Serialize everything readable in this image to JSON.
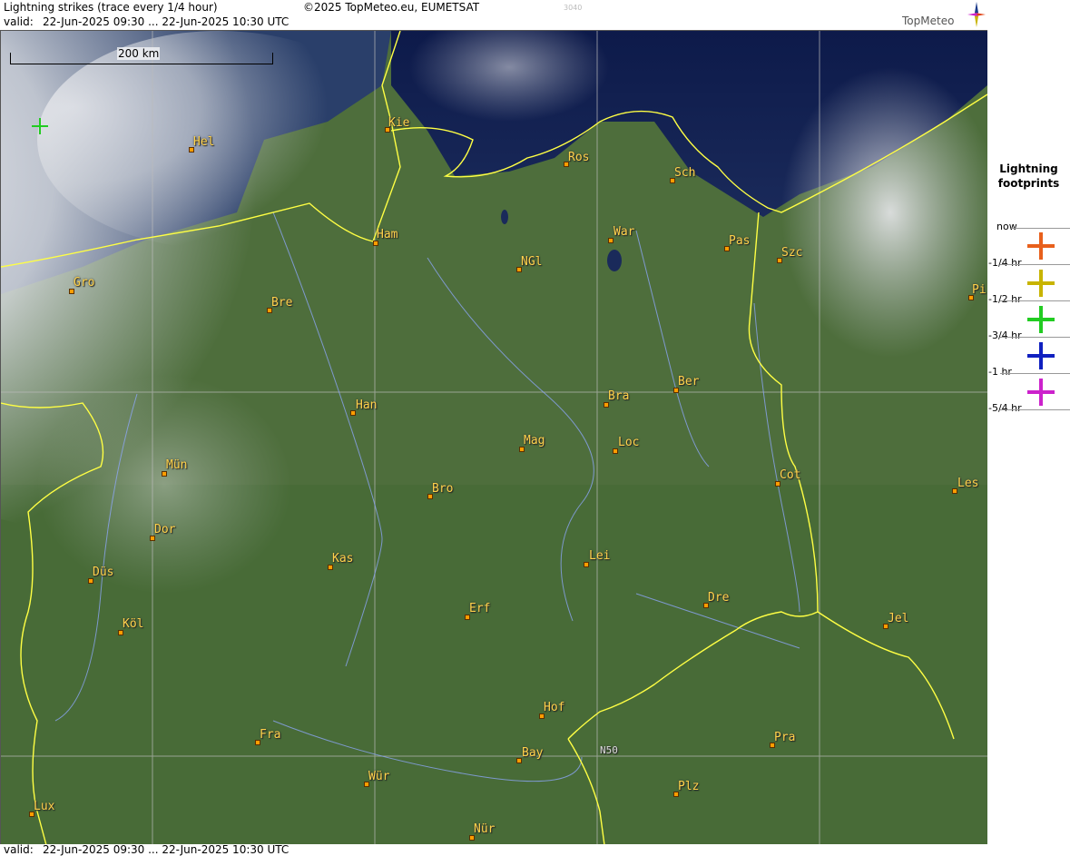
{
  "header": {
    "title": "Lightning strikes (trace every 1/4 hour)",
    "copyright": "©2025 TopMeteo.eu, EUMETSAT",
    "code": "3040",
    "valid_label": "valid:",
    "valid_range": "22-Jun-2025 09:30 ... 22-Jun-2025 10:30 UTC",
    "logo_text": "TopMeteo"
  },
  "footer": {
    "valid_label": "valid:",
    "valid_range": "22-Jun-2025 09:30 ... 22-Jun-2025 10:30 UTC"
  },
  "map": {
    "scale_label": "200 km",
    "gridline_label": "N50",
    "cities": [
      "Kie",
      "Hel",
      "Ros",
      "Sch",
      "Ham",
      "War",
      "Pas",
      "Szc",
      "NGl",
      "Gro",
      "Bre",
      "Pi",
      "Ber",
      "Bra",
      "Han",
      "Mag",
      "Loc",
      "Mün",
      "Cot",
      "Les",
      "Bro",
      "Dor",
      "Kas",
      "Lei",
      "Düs",
      "Erf",
      "Dre",
      "Jel",
      "Köl",
      "Hof",
      "Fra",
      "Pra",
      "Bay",
      "Wür",
      "Plz",
      "Lux",
      "Nür"
    ]
  },
  "legend": {
    "title_line1": "Lightning",
    "title_line2": "footprints",
    "entries": [
      {
        "label": "now",
        "color": "#e8601c"
      },
      {
        "label": "-1/4 hr",
        "color": "#c8b400"
      },
      {
        "label": "-1/2 hr",
        "color": "#22cc22"
      },
      {
        "label": "-3/4 hr",
        "color": "#1020c0"
      },
      {
        "label": "-1 hr",
        "color": "#cc22cc"
      },
      {
        "label": "-5/4 hr",
        "color": ""
      }
    ]
  },
  "strikes": [
    {
      "age": "-1/2 hr",
      "color": "#22cc22"
    }
  ]
}
